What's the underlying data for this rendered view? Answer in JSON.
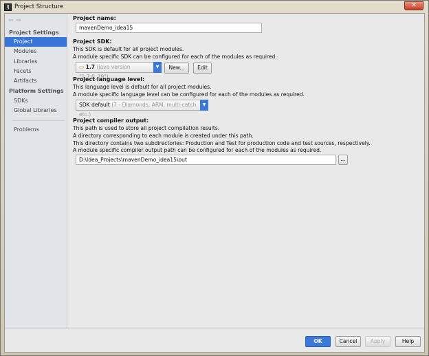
{
  "window": {
    "title": "Project Structure",
    "close": "✕"
  },
  "sidebar": {
    "sections": [
      {
        "label": "Project Settings"
      },
      {
        "label": "Platform Settings"
      }
    ],
    "items": [
      {
        "label": "Project"
      },
      {
        "label": "Modules"
      },
      {
        "label": "Libraries"
      },
      {
        "label": "Facets"
      },
      {
        "label": "Artifacts"
      },
      {
        "label": "SDKs"
      },
      {
        "label": "Global Libraries"
      },
      {
        "label": "Problems"
      }
    ]
  },
  "main": {
    "name_label": "Project name:",
    "name_value": "mavenDemo_idea15",
    "sdk_label": "Project SDK:",
    "sdk_desc1": "This SDK is default for all project modules.",
    "sdk_desc2": "A module specific SDK can be configured for each of the modules as required.",
    "sdk_value": "1.7",
    "sdk_detail": "(java version \"1.7.0_79\")",
    "new_button": "New...",
    "edit_button": "Edit",
    "lang_label": "Project language level:",
    "lang_desc1": "This language level is default for all project modules.",
    "lang_desc2": "A module specific language level can be configured for each of the modules as required.",
    "lang_value": "SDK default",
    "lang_detail": "(7 - Diamonds, ARM, multi-catch etc.)",
    "out_label": "Project compiler output:",
    "out_desc1": "This path is used to store all project compilation results.",
    "out_desc2": "A directory corresponding to each module is created under this path.",
    "out_desc3": "This directory contains two subdirectories: Production and Test for production code and test sources, respectively.",
    "out_desc4": "A module specific compiler output path can be configured for each of the modules as required.",
    "out_value": "D:\\Idea_Projects\\mavenDemo_idea15\\out",
    "browse": "..."
  },
  "footer": {
    "ok": "OK",
    "cancel": "Cancel",
    "apply": "Apply",
    "help": "Help"
  }
}
